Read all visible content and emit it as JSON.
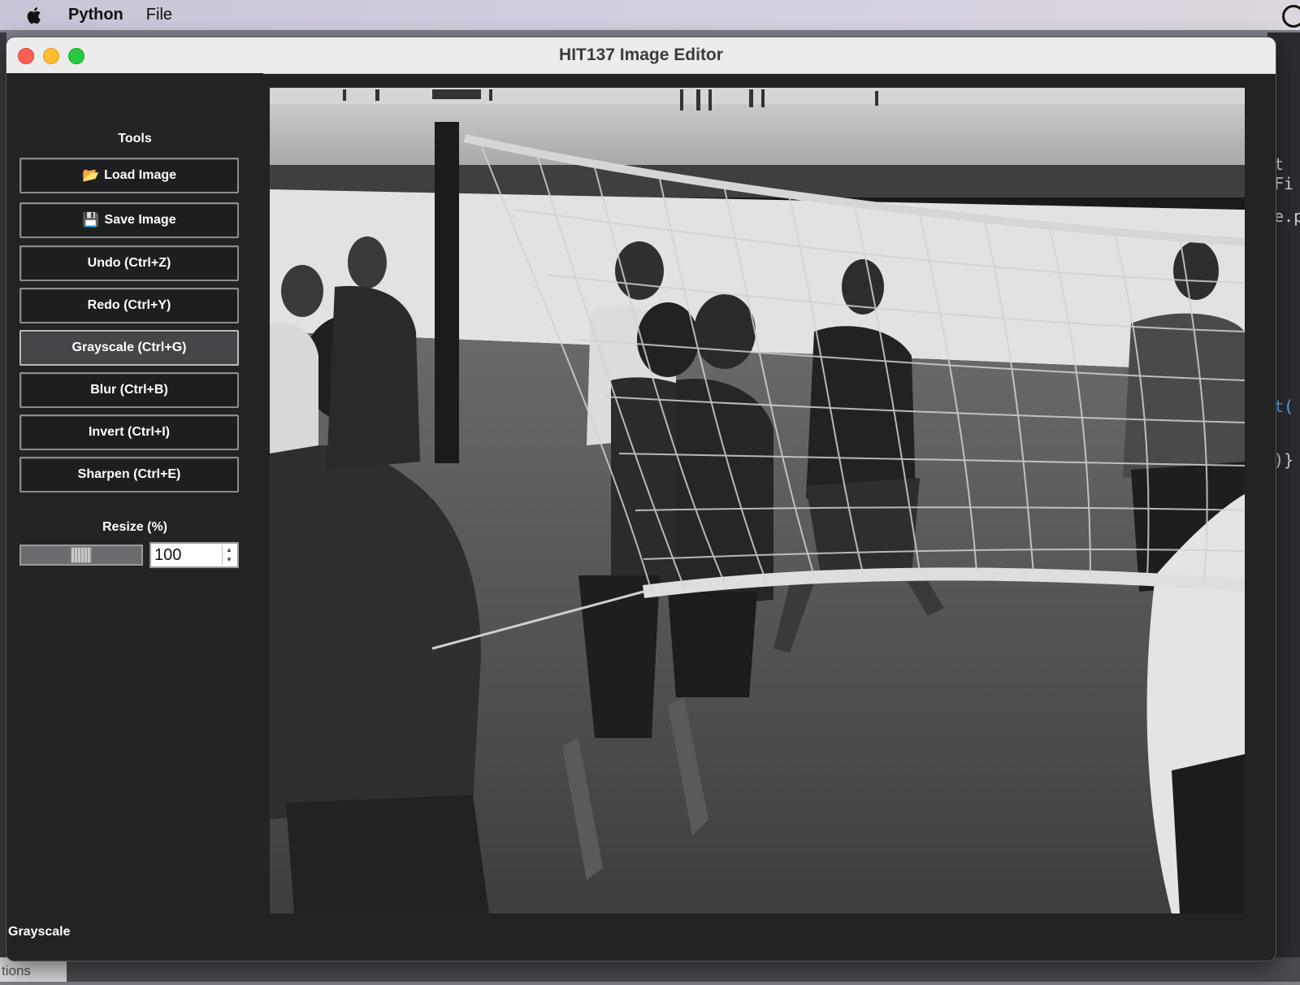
{
  "menubar": {
    "app_name": "Python",
    "file_menu": "File"
  },
  "window": {
    "title": "HIT137 Image Editor"
  },
  "sidebar": {
    "section_title": "Tools",
    "buttons": [
      {
        "label": "Load Image",
        "icon": "📂"
      },
      {
        "label": "Save Image",
        "icon": "💾"
      },
      {
        "label": "Undo (Ctrl+Z)"
      },
      {
        "label": "Redo (Ctrl+Y)"
      },
      {
        "label": "Grayscale (Ctrl+G)"
      },
      {
        "label": "Blur (Ctrl+B)"
      },
      {
        "label": "Invert (Ctrl+I)"
      },
      {
        "label": "Sharpen (Ctrl+E)"
      }
    ],
    "active_button": "Grayscale (Ctrl+G)",
    "resize": {
      "label": "Resize (%)",
      "value": "100",
      "slider_fraction": 0.5
    }
  },
  "status_bar": {
    "text": "Grayscale"
  },
  "canvas": {
    "image_description_icon": "grayscale-photo"
  },
  "background": {
    "editor_snippets": [
      "t Fi",
      "e.py",
      "t(",
      ")}"
    ],
    "dock_tab": "tions"
  }
}
